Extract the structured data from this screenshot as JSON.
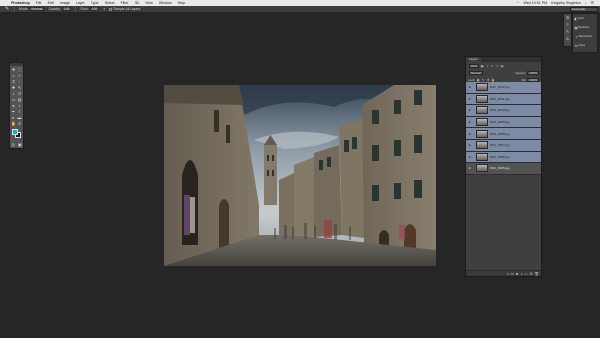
{
  "menubar": {
    "app_name": "Photoshop",
    "items": [
      "File",
      "Edit",
      "Image",
      "Layer",
      "Type",
      "Select",
      "Filter",
      "3D",
      "View",
      "Window",
      "Help"
    ],
    "clock": "Wed 10:51 PM",
    "user": "Kingsley Singleton"
  },
  "options_bar": {
    "mode_label": "Mode:",
    "mode_value": "Normal",
    "opacity_label": "Opacity:",
    "opacity_value": "100",
    "flow_label": "Flow:",
    "flow_value": "100",
    "sample_label": "Sample All Layers",
    "workspace": "Essentials"
  },
  "right_mini_panels": {
    "items": [
      {
        "icon": "color-swatch-icon",
        "label": "Color"
      },
      {
        "icon": "swatches-icon",
        "label": "Swatches"
      },
      {
        "icon": "adjustments-icon",
        "label": "Adjustments"
      },
      {
        "icon": "styles-icon",
        "label": "Styles"
      }
    ]
  },
  "layers_panel": {
    "tabs": [
      "Layers"
    ],
    "kind_label": "Kind",
    "blend_mode": "Normal",
    "opacity_label": "Opacity:",
    "opacity_value": "100%",
    "lock_label": "Lock:",
    "fill_label": "Fill:",
    "fill_value": "100%",
    "layers": [
      {
        "name": "DSC_0012.jpg",
        "selected": true
      },
      {
        "name": "DSC_0011.jpg",
        "selected": true
      },
      {
        "name": "DSC_0010.jpg",
        "selected": true
      },
      {
        "name": "DSC_0009.jpg",
        "selected": true
      },
      {
        "name": "DSC_0008.jpg",
        "selected": true
      },
      {
        "name": "DSC_0007.jpg",
        "selected": true
      },
      {
        "name": "DSC_0006.jpg",
        "selected": true
      },
      {
        "name": "DSC_0005.jpg",
        "selected": false
      }
    ]
  },
  "colors": {
    "foreground": "#00b4dc",
    "background": "#1a1a1a",
    "selected_layer": "#7d8ba6"
  }
}
